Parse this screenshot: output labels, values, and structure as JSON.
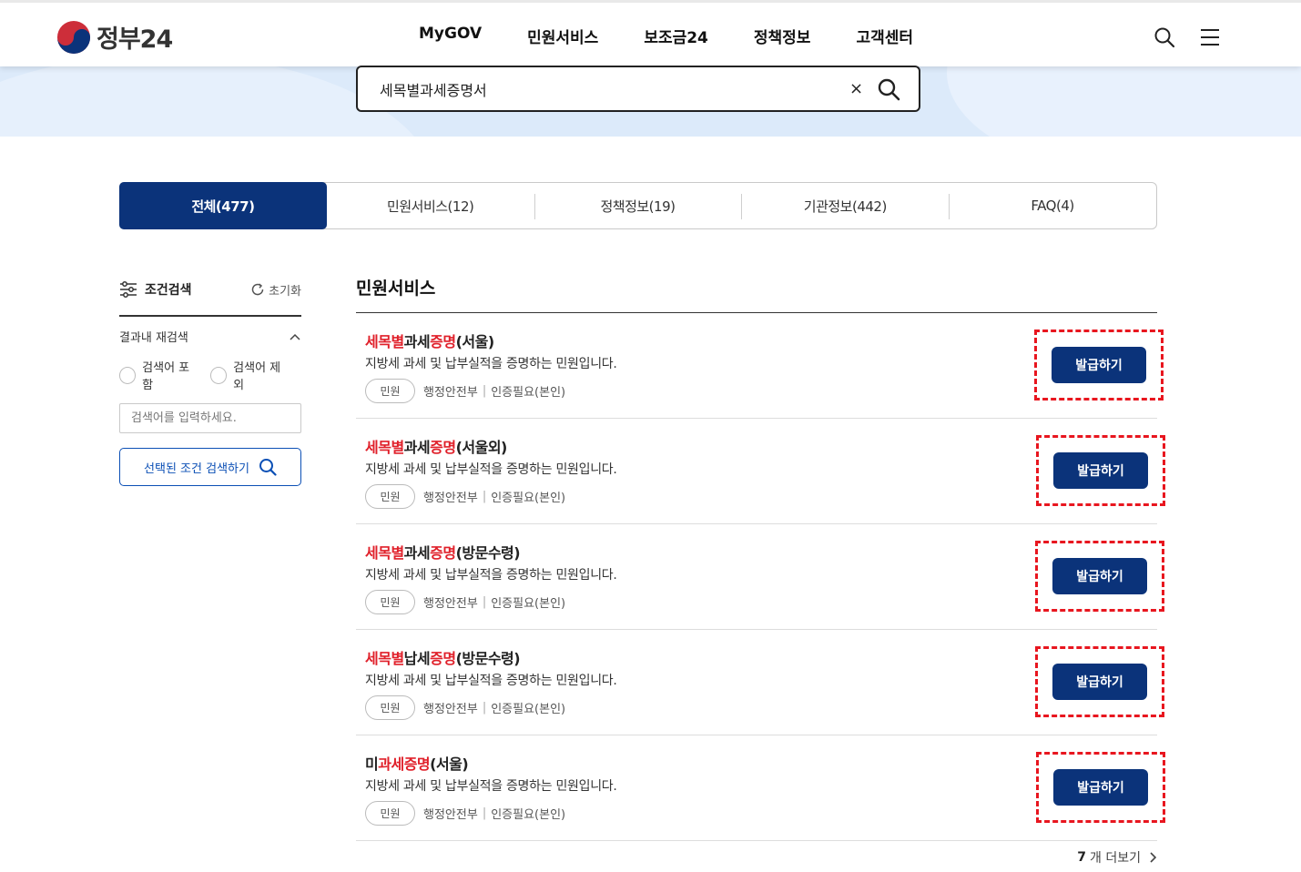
{
  "brand": {
    "logo_text": "정부24"
  },
  "nav": [
    "MyGOV",
    "민원서비스",
    "보조금24",
    "정책정보",
    "고객센터"
  ],
  "search": {
    "value": "세목별과세증명서",
    "clear_label": "×"
  },
  "tabs": [
    {
      "label": "전체(477)"
    },
    {
      "label": "민원서비스(12)"
    },
    {
      "label": "정책정보(19)"
    },
    {
      "label": "기관정보(442)"
    },
    {
      "label": "FAQ(4)"
    }
  ],
  "sidebar": {
    "title": "조건검색",
    "reset_label": "초기화",
    "refine_label": "결과내 재검색",
    "radio_include": "검색어 포함",
    "radio_exclude": "검색어 제외",
    "keyword_placeholder": "검색어를 입력하세요.",
    "search_button": "선택된 조건 검색하기"
  },
  "results": {
    "section_title": "민원서비스",
    "items": [
      {
        "title_parts": [
          [
            "세목별",
            "hl"
          ],
          [
            "과세",
            ""
          ],
          [
            "증명",
            "hl"
          ],
          [
            "(서울)",
            ""
          ]
        ],
        "desc": "지방세 과세 및 납부실적을 증명하는 민원입니다.",
        "chip": "민원",
        "agency": "행정안전부",
        "auth": "인증필요(본인)",
        "button": "발급하기"
      },
      {
        "title_parts": [
          [
            "세목별",
            "hl"
          ],
          [
            "과세",
            ""
          ],
          [
            "증명",
            "hl"
          ],
          [
            "(서울외)",
            ""
          ]
        ],
        "desc": "지방세 과세 및 납부실적을 증명하는 민원입니다.",
        "chip": "민원",
        "agency": "행정안전부",
        "auth": "인증필요(본인)",
        "button": "발급하기"
      },
      {
        "title_parts": [
          [
            "세목별",
            "hl"
          ],
          [
            "과세",
            ""
          ],
          [
            "증명",
            "hl"
          ],
          [
            "(방문수령)",
            ""
          ]
        ],
        "desc": "지방세 과세 및 납부실적을 증명하는 민원입니다.",
        "chip": "민원",
        "agency": "행정안전부",
        "auth": "인증필요(본인)",
        "button": "발급하기"
      },
      {
        "title_parts": [
          [
            "세목별",
            "hl"
          ],
          [
            "납세",
            ""
          ],
          [
            "증명",
            "hl"
          ],
          [
            "(방문수령)",
            ""
          ]
        ],
        "desc": "지방세 과세 및 납부실적을 증명하는 민원입니다.",
        "chip": "민원",
        "agency": "행정안전부",
        "auth": "인증필요(본인)",
        "button": "발급하기"
      },
      {
        "title_parts": [
          [
            "미",
            ""
          ],
          [
            "과세",
            "hl"
          ],
          [
            "증명",
            "hl"
          ],
          [
            "(서울)",
            ""
          ]
        ],
        "desc": "지방세 과세 및 납부실적을 증명하는 민원입니다.",
        "chip": "민원",
        "agency": "행정안전부",
        "auth": "인증필요(본인)",
        "button": "발급하기"
      }
    ],
    "more_count": "7",
    "more_label": "개 더보기"
  },
  "colors": {
    "primary": "#0b337a",
    "highlight": "#e0202a",
    "dashed_outline": "#e8161f"
  }
}
